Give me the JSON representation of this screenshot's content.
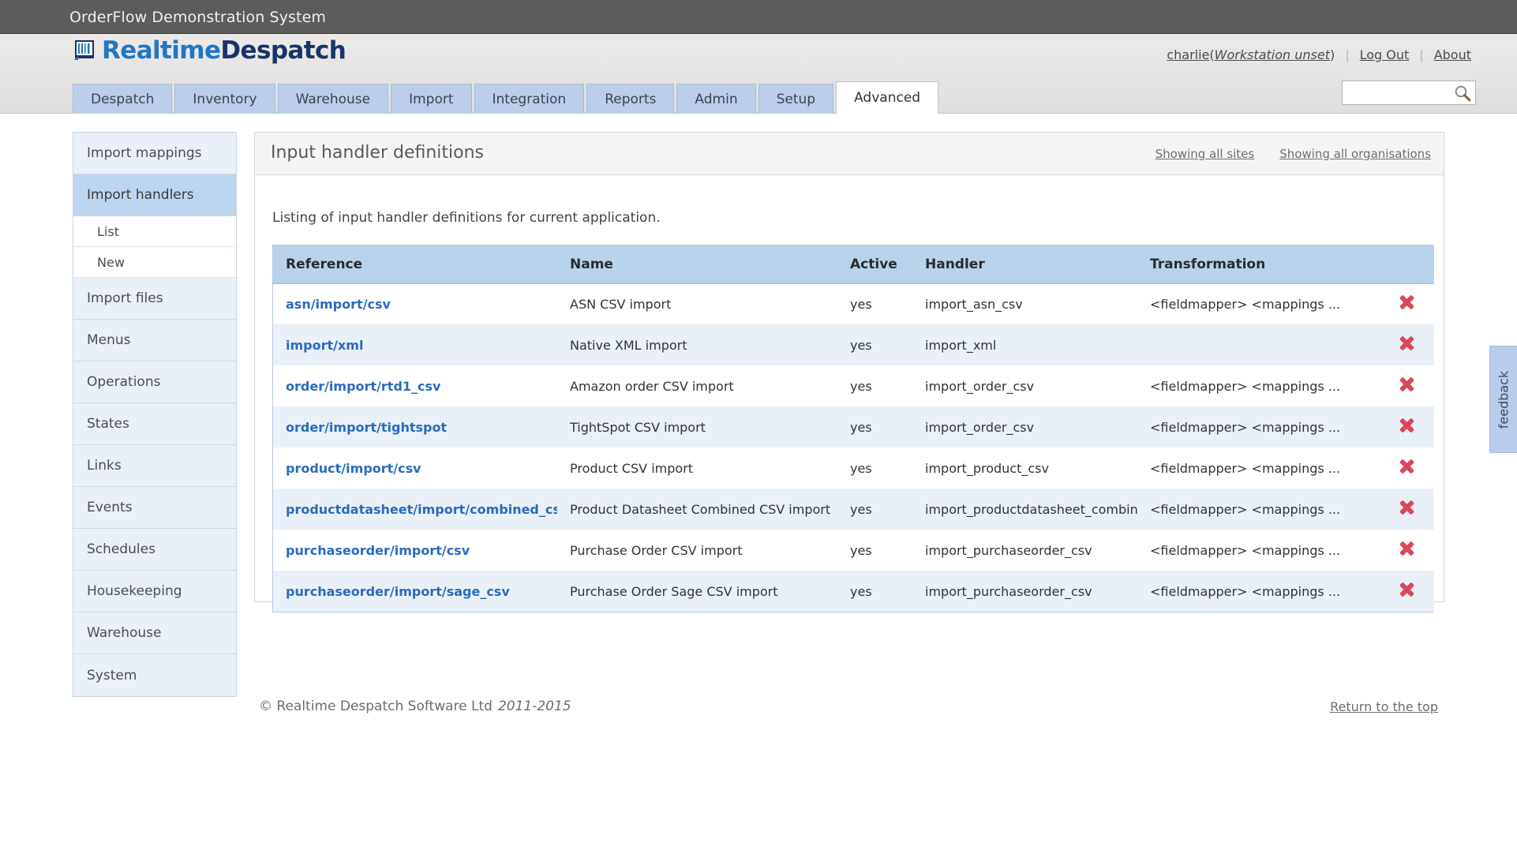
{
  "window": {
    "title": "OrderFlow Demonstration System"
  },
  "brand": {
    "name_part1": "Realtime",
    "name_part2": "Despatch",
    "color_part1": "#2277c4",
    "color_part2": "#17346b"
  },
  "userbar": {
    "username": "charlie",
    "workstation_open": "(",
    "workstation": "Workstation unset",
    "workstation_close": ")",
    "logout": "Log Out",
    "about": "About"
  },
  "search": {
    "value": "",
    "placeholder": ""
  },
  "tabs": [
    {
      "label": "Despatch",
      "active": false
    },
    {
      "label": "Inventory",
      "active": false
    },
    {
      "label": "Warehouse",
      "active": false
    },
    {
      "label": "Import",
      "active": false
    },
    {
      "label": "Integration",
      "active": false
    },
    {
      "label": "Reports",
      "active": false
    },
    {
      "label": "Admin",
      "active": false
    },
    {
      "label": "Setup",
      "active": false
    },
    {
      "label": "Advanced",
      "active": true
    }
  ],
  "sidebar": {
    "items": [
      {
        "label": "Import mappings",
        "type": "item",
        "selected": false
      },
      {
        "label": "Import handlers",
        "type": "item",
        "selected": true
      },
      {
        "label": "List",
        "type": "sub",
        "selected": false
      },
      {
        "label": "New",
        "type": "sub",
        "selected": false
      },
      {
        "label": "Import files",
        "type": "item",
        "selected": false
      },
      {
        "label": "Menus",
        "type": "item",
        "selected": false
      },
      {
        "label": "Operations",
        "type": "item",
        "selected": false
      },
      {
        "label": "States",
        "type": "item",
        "selected": false
      },
      {
        "label": "Links",
        "type": "item",
        "selected": false
      },
      {
        "label": "Events",
        "type": "item",
        "selected": false
      },
      {
        "label": "Schedules",
        "type": "item",
        "selected": false
      },
      {
        "label": "Housekeeping",
        "type": "item",
        "selected": false
      },
      {
        "label": "Warehouse",
        "type": "item",
        "selected": false
      },
      {
        "label": "System",
        "type": "item",
        "selected": false
      }
    ]
  },
  "content": {
    "title": "Input handler definitions",
    "header_links": [
      {
        "label": "Showing all sites"
      },
      {
        "label": "Showing all organisations"
      }
    ],
    "note": "Listing of input handler definitions for current application."
  },
  "table": {
    "columns": [
      "Reference",
      "Name",
      "Active",
      "Handler",
      "Transformation",
      ""
    ],
    "rows": [
      {
        "reference": "asn/import/csv",
        "name": "ASN CSV import",
        "active": "yes",
        "handler": "import_asn_csv",
        "transformation": "<fieldmapper> <mappings ...",
        "delete_icon": "delete-x-icon"
      },
      {
        "reference": "import/xml",
        "name": "Native XML import",
        "active": "yes",
        "handler": "import_xml",
        "transformation": "",
        "delete_icon": "delete-x-icon"
      },
      {
        "reference": "order/import/rtd1_csv",
        "name": "Amazon order CSV import",
        "active": "yes",
        "handler": "import_order_csv",
        "transformation": "<fieldmapper> <mappings ...",
        "delete_icon": "delete-x-icon"
      },
      {
        "reference": "order/import/tightspot",
        "name": "TightSpot CSV import",
        "active": "yes",
        "handler": "import_order_csv",
        "transformation": "<fieldmapper> <mappings ...",
        "delete_icon": "delete-x-icon"
      },
      {
        "reference": "product/import/csv",
        "name": "Product CSV import",
        "active": "yes",
        "handler": "import_product_csv",
        "transformation": "<fieldmapper> <mappings ...",
        "delete_icon": "delete-x-icon"
      },
      {
        "reference": "productdatasheet/import/combined_csv",
        "name": "Product Datasheet Combined CSV import",
        "active": "yes",
        "handler": "import_productdatasheet_combined_csv",
        "transformation": "<fieldmapper> <mappings ...",
        "delete_icon": "delete-x-icon"
      },
      {
        "reference": "purchaseorder/import/csv",
        "name": "Purchase Order CSV import",
        "active": "yes",
        "handler": "import_purchaseorder_csv",
        "transformation": "<fieldmapper> <mappings ...",
        "delete_icon": "delete-x-icon"
      },
      {
        "reference": "purchaseorder/import/sage_csv",
        "name": "Purchase Order Sage CSV import",
        "active": "yes",
        "handler": "import_purchaseorder_csv",
        "transformation": "<fieldmapper> <mappings ...",
        "delete_icon": "delete-x-icon"
      }
    ]
  },
  "footer": {
    "copyright": "© Realtime Despatch Software Ltd",
    "years": "2011-2015",
    "return_to_top": "Return to the top"
  },
  "feedback": {
    "label": "feedback"
  }
}
